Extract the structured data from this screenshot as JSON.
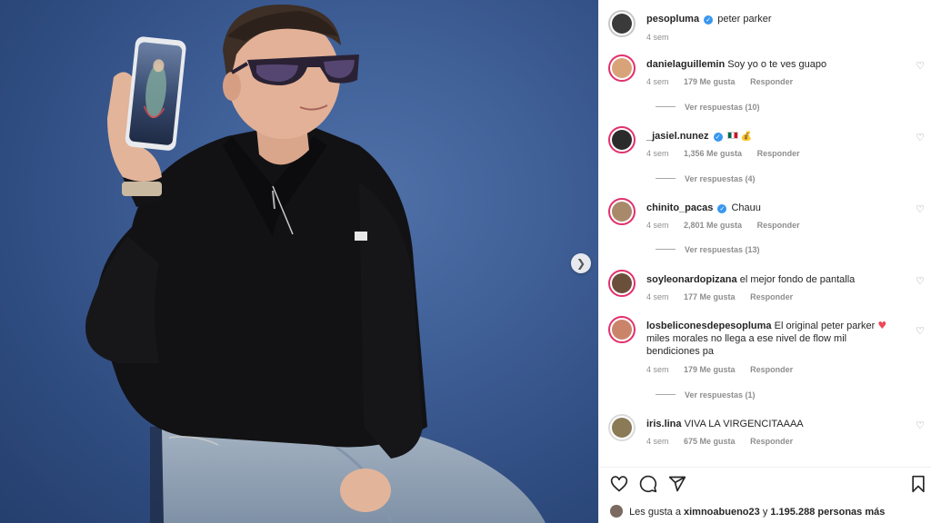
{
  "post": {
    "username": "pesopluma",
    "caption": "peter parker",
    "time": "4 sem"
  },
  "comments": [
    {
      "username": "danielaguillemin",
      "text": "Soy yo o te ves guapo",
      "time": "4 sem",
      "likes": "179 Me gusta",
      "reply_label": "Responder",
      "view_replies": "Ver respuestas (10)",
      "avatar_color": "#d9a37a"
    },
    {
      "username": "_jasiel.nunez",
      "text": "",
      "time": "4 sem",
      "likes": "1,356 Me gusta",
      "reply_label": "Responder",
      "view_replies": "Ver respuestas (4)",
      "avatar_color": "#2b2b2b",
      "emojis": [
        "mexico-flag",
        "money-bag"
      ]
    },
    {
      "username": "chinito_pacas",
      "text": "Chauu",
      "time": "4 sem",
      "likes": "2,801 Me gusta",
      "reply_label": "Responder",
      "view_replies": "Ver respuestas (13)",
      "avatar_color": "#a88a6a"
    },
    {
      "username": "soyleonardopizana",
      "text": "el mejor fondo de pantalla",
      "time": "4 sem",
      "likes": "177 Me gusta",
      "reply_label": "Responder",
      "avatar_color": "#6a4f3a"
    },
    {
      "username": "losbeliconesdepesopluma",
      "text": "El original peter parker",
      "text_cont": "miles morales no llega a ese nivel de flow mil bendiciones pa",
      "time": "4 sem",
      "likes": "179 Me gusta",
      "reply_label": "Responder",
      "view_replies": "Ver respuestas (1)",
      "avatar_color": "#c9846a"
    },
    {
      "username": "iris.lina",
      "text": "VIVA LA VIRGENCITAAAA",
      "time": "4 sem",
      "likes": "675 Me gusta",
      "reply_label": "Responder",
      "avatar_color": "#8a7a55"
    }
  ],
  "likes_summary": {
    "prefix": "Les gusta a",
    "user": "ximnoabueno23",
    "middle": "y",
    "count": "1.195.288 personas más"
  },
  "colors": {
    "photo_background": "#3f5f97",
    "verified": "#3897f0",
    "story_ring": "#e1306c",
    "heart_red": "#ed4956"
  },
  "icons": [
    "chevron-right-icon",
    "heart-icon",
    "comment-icon",
    "share-icon",
    "bookmark-icon",
    "verified-icon"
  ]
}
